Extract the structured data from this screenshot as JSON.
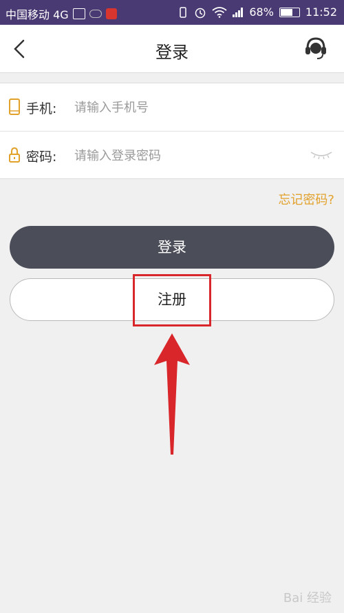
{
  "status_bar": {
    "carrier": "中国移动 4G",
    "network": "4G",
    "battery": "68%",
    "battery_level": 0.68,
    "time": "11:52"
  },
  "header": {
    "title": "登录",
    "back_icon": "chevron-left-icon",
    "support_icon": "headset-icon"
  },
  "form": {
    "phone": {
      "label": "手机:",
      "placeholder": "请输入手机号",
      "icon": "phone-icon",
      "value": ""
    },
    "password": {
      "label": "密码:",
      "placeholder": "请输入登录密码",
      "icon": "lock-icon",
      "value": "",
      "visibility_icon": "eye-closed-icon"
    }
  },
  "forgot_password": "忘记密码?",
  "login_button": "登录",
  "register_button": "注册",
  "annotation": {
    "color": "#d9262b"
  },
  "colors": {
    "status_bar": "#4a3a73",
    "accent": "#e2a12b",
    "primary_button": "#4b4d58"
  },
  "watermark": "Bai 经验"
}
